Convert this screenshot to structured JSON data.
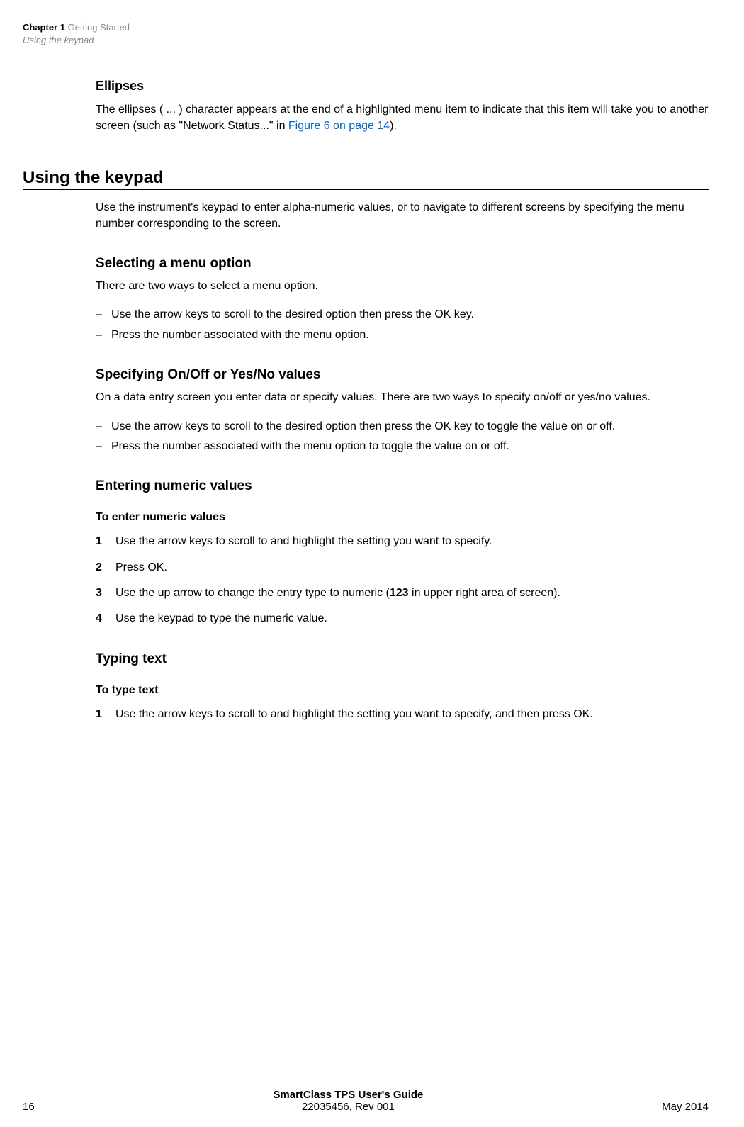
{
  "header": {
    "chapter_label": "Chapter 1",
    "chapter_title": "Getting Started",
    "subtitle": "Using the keypad"
  },
  "s_ellipses": {
    "heading": "Ellipses",
    "p1_a": "The ellipses ( ... ) character appears at the end of a highlighted menu item to indicate that this item will take you to another screen (such as \"Network Status...\" in ",
    "link": "Figure 6 on page 14",
    "p1_b": ")."
  },
  "h2": "Using the keypad",
  "p_intro": "Use the instrument's keypad to enter alpha-numeric values, or to navigate to different screens by specifying the menu number corresponding to the screen.",
  "s_select": {
    "heading": "Selecting a menu option",
    "p1": "There are two ways to select a menu option.",
    "d1": "Use the arrow keys to scroll to the desired option then press the OK key.",
    "d2": "Press the number associated with the menu option."
  },
  "s_onoff": {
    "heading": "Specifying On/Off or Yes/No values",
    "p1": "On a data entry screen you enter data or specify values. There are two ways to specify on/off or yes/no values.",
    "d1": "Use the arrow keys to scroll to the desired option then press the OK key to toggle the value on or off.",
    "d2": "Press the number associated with the menu option to toggle the value on or off."
  },
  "s_numeric": {
    "heading": "Entering numeric values",
    "sub": "To enter numeric values",
    "n1": "Use the arrow keys to scroll to and highlight the setting you want to specify.",
    "n2": "Press OK.",
    "n3_a": "Use the up arrow to change the entry type to numeric (",
    "n3_b": "123",
    "n3_c": " in upper right area of screen).",
    "n4": "Use the keypad to type the numeric value."
  },
  "s_typing": {
    "heading": "Typing text",
    "sub": "To type text",
    "n1": "Use the arrow keys to scroll to and highlight the setting you want to specify, and then press OK."
  },
  "footer": {
    "page": "16",
    "title": "SmartClass TPS User's Guide",
    "rev": "22035456, Rev 001",
    "date": "May 2014"
  }
}
